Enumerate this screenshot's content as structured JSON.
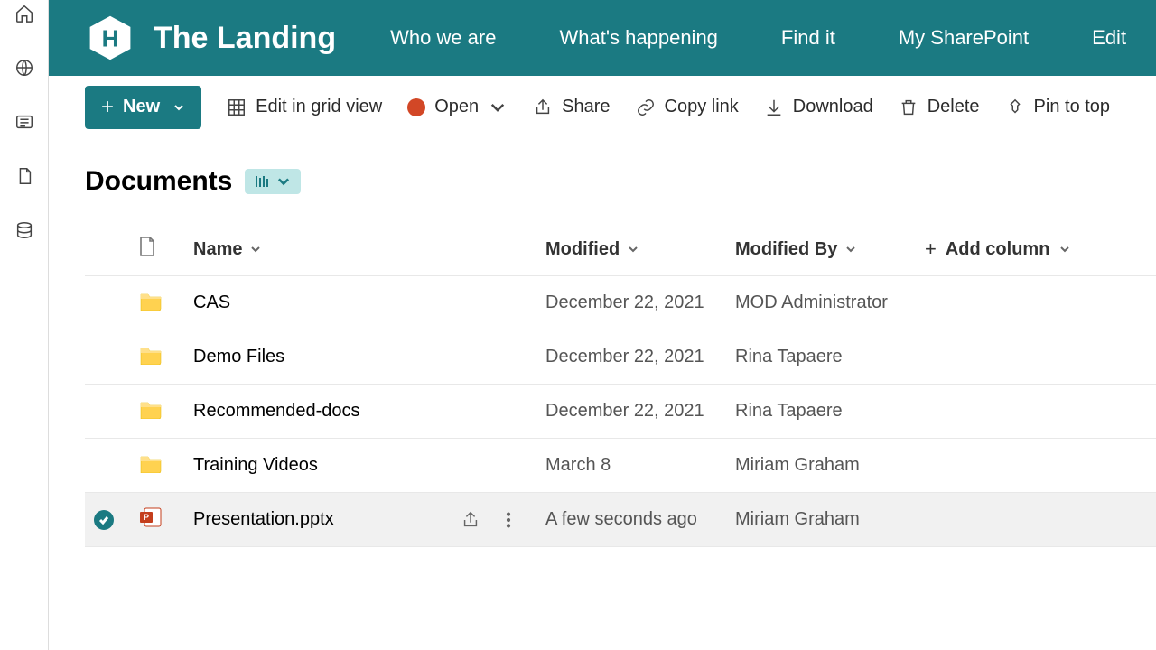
{
  "site": {
    "title": "The Landing"
  },
  "nav": [
    "Who we are",
    "What's happening",
    "Find it",
    "My SharePoint",
    "Edit"
  ],
  "commands": {
    "new": "New",
    "editgrid": "Edit in grid view",
    "open": "Open",
    "share": "Share",
    "copylink": "Copy link",
    "download": "Download",
    "delete": "Delete",
    "pin": "Pin to top"
  },
  "library": {
    "title": "Documents"
  },
  "columns": {
    "name": "Name",
    "modified": "Modified",
    "modifiedBy": "Modified By",
    "add": "Add column"
  },
  "rows": [
    {
      "type": "folder",
      "name": "CAS",
      "modified": "December 22, 2021",
      "by": "MOD Administrator",
      "selected": false
    },
    {
      "type": "folder",
      "name": "Demo Files",
      "modified": "December 22, 2021",
      "by": "Rina Tapaere",
      "selected": false
    },
    {
      "type": "folder",
      "name": "Recommended-docs",
      "modified": "December 22, 2021",
      "by": "Rina Tapaere",
      "selected": false
    },
    {
      "type": "folder",
      "name": "Training Videos",
      "modified": "March 8",
      "by": "Miriam Graham",
      "selected": false
    },
    {
      "type": "pptx",
      "name": "Presentation.pptx",
      "modified": "A few seconds ago",
      "by": "Miriam Graham",
      "selected": true
    }
  ]
}
